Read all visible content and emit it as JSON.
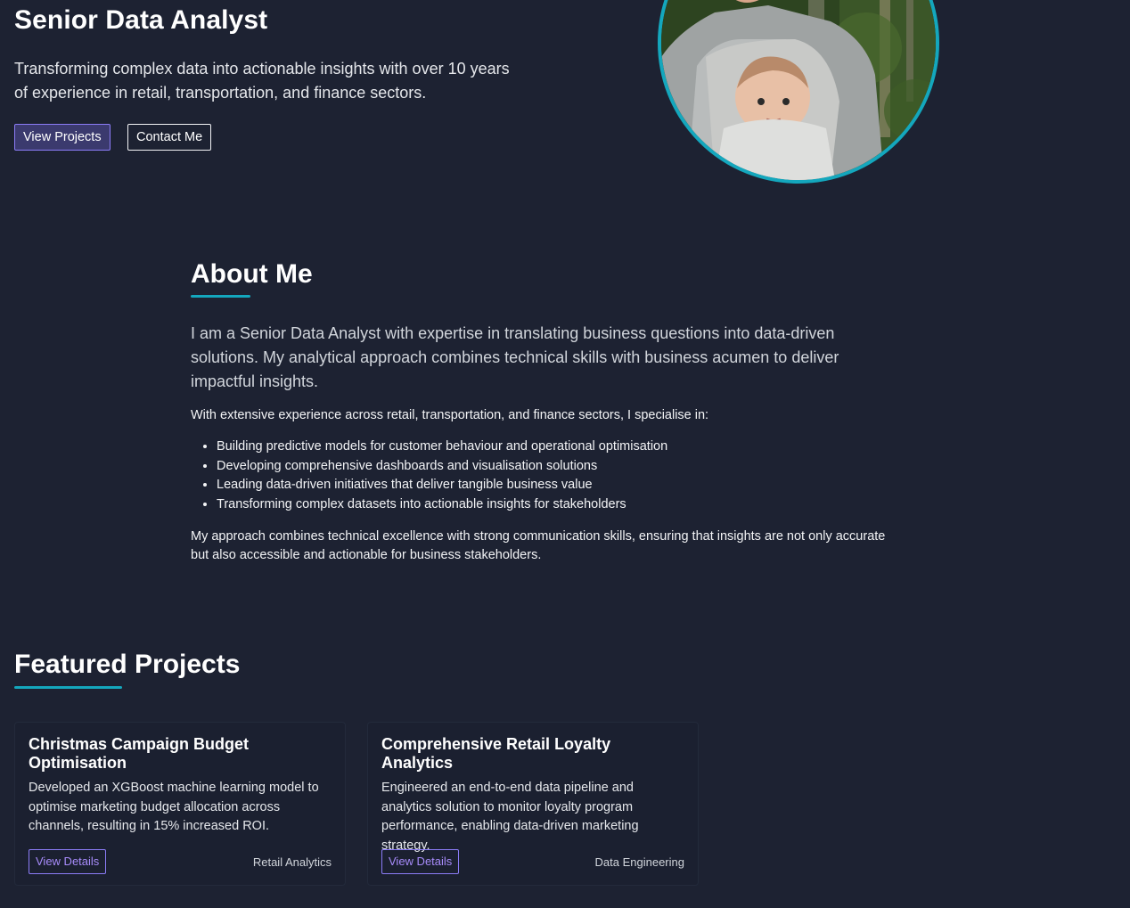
{
  "hero": {
    "title": "Senior Data Analyst",
    "subtitle": "Transforming complex data into actionable insights with over 10 years of experience in retail, transportation, and finance sectors.",
    "primary_button": "View Projects",
    "secondary_button": "Contact Me",
    "accent_color": "#14a7bd"
  },
  "about": {
    "title": "About Me",
    "lead": "I am a Senior Data Analyst with expertise in translating business questions into data-driven solutions. My analytical approach combines technical skills with business acumen to deliver impactful insights.",
    "intro": "With extensive experience across retail, transportation, and finance sectors, I specialise in:",
    "items": [
      "Building predictive models for customer behaviour and operational optimisation",
      "Developing comprehensive dashboards and visualisation solutions",
      "Leading data-driven initiatives that deliver tangible business value",
      "Transforming complex datasets into actionable insights for stakeholders"
    ],
    "closing": "My approach combines technical excellence with strong communication skills, ensuring that insights are not only accurate but also accessible and actionable for business stakeholders."
  },
  "projects": {
    "title": "Featured Projects",
    "cards": [
      {
        "title": "Christmas Campaign Budget Optimisation",
        "description": "Developed an XGBoost machine learning model to optimise marketing budget allocation across channels, resulting in 15% increased ROI.",
        "button": "View Details",
        "tag": "Retail Analytics"
      },
      {
        "title": "Comprehensive Retail Loyalty Analytics",
        "description": "Engineered an end-to-end data pipeline and analytics solution to monitor loyalty program performance, enabling data-driven marketing strategy.",
        "button": "View Details",
        "tag": "Data Engineering"
      }
    ]
  }
}
